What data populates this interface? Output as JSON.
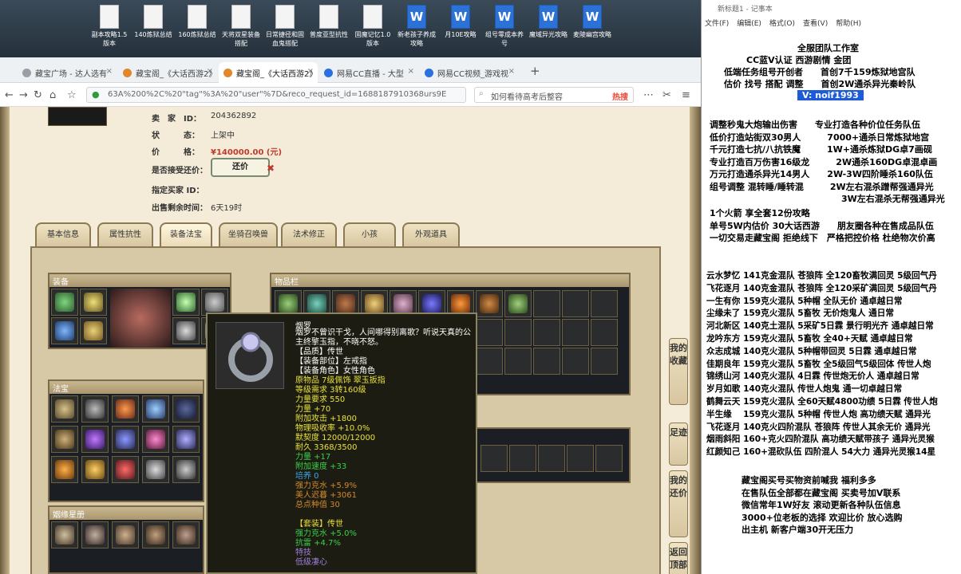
{
  "desktop": {
    "icons": [
      "副本攻略1.5版本",
      "140炼狱总结",
      "160炼狱总结",
      "天将双星装备搭配",
      "日常捷径和固血鬼搭配",
      "普度亚型抗性",
      "固魔记忆1.0版本",
      "新老孩子养成攻略",
      "月10E攻略",
      "组号零成本养号",
      "魔域异光攻略",
      "麦陵幽宫攻略"
    ]
  },
  "browser": {
    "tabs": [
      {
        "label": "藏宝广场 - 达人选有",
        "active": false
      },
      {
        "label": "藏宝阁_《大话西游2》",
        "active": false
      },
      {
        "label": "藏宝阁_《大话西游2》",
        "active": true
      },
      {
        "label": "网易CC直播 - 大型",
        "active": false
      },
      {
        "label": "网易CC视频_游戏视",
        "active": false
      }
    ],
    "url": "63A%200%2C%20\"tag\"%3A%20\"user\"%7D&reco_request_id=1688187910368urs9E",
    "search_placeholder": "如何看待高考后整容",
    "search_badge": "热搜"
  },
  "listing": {
    "seller_label": "卖　家　ID：",
    "seller_id": "204362892",
    "status_label": "状　　　态：",
    "status": "上架中",
    "price_label": "价　　　格：",
    "price": "¥140000.00 (元)",
    "offer_label": "是否接受还价：",
    "offer_button": "还价",
    "buyer_label": "指定买家 ID：",
    "buyer": "",
    "time_label": "出售剩余时间：",
    "time_left": "6天19时"
  },
  "game_tabs": [
    "基本信息",
    "属性抗性",
    "装备法宝",
    "坐骑召唤兽",
    "法术修正",
    "小孩",
    "外观道具"
  ],
  "sections": {
    "equip": "装备",
    "inventory": "物品栏",
    "treasure": "法宝",
    "star": "姻缘星册"
  },
  "side_tabs": [
    "我的收藏",
    "足迹",
    "我的还价",
    "返回顶部"
  ],
  "tooltip": {
    "name": "烟罗",
    "desc": "烟罗不曾识干戈，人间哪得别离歌？听说天真的公主终擎玉指，不晓不怒。",
    "lines": [
      {
        "t": "【品质】传世",
        "c": "#ffffff"
      },
      {
        "t": "【装备部位】左戒指",
        "c": "#ffffff"
      },
      {
        "t": "【装备角色】女性角色",
        "c": "#ffffff"
      },
      {
        "t": "原物品 7级佩饰 翠玉扳指",
        "c": "#e8e23a"
      },
      {
        "t": "等级需求 3转160级",
        "c": "#e8e23a"
      },
      {
        "t": "力量要求 550",
        "c": "#e8e23a"
      },
      {
        "t": "力量 +70",
        "c": "#e8e23a"
      },
      {
        "t": "附加攻击 +1800",
        "c": "#e8e23a"
      },
      {
        "t": "物理吸收率 +10.0%",
        "c": "#e8e23a"
      },
      {
        "t": "默契度 12000/12000",
        "c": "#e8e23a"
      },
      {
        "t": "耐久 3368/3500",
        "c": "#e8e23a"
      },
      {
        "t": "力量 +17",
        "c": "#39d14a"
      },
      {
        "t": "附加速度 +33",
        "c": "#39d14a"
      },
      {
        "t": "培养 0",
        "c": "#3aa7e8"
      },
      {
        "t": "强力克水 +5.9%",
        "c": "#d08a2e"
      },
      {
        "t": "美人迟暮 +3061",
        "c": "#d08a2e"
      },
      {
        "t": "总点种值 30",
        "c": "#d08a2e"
      },
      {
        "t": "",
        "c": "#fff"
      },
      {
        "t": "【套装】传世",
        "c": "#e8e23a"
      },
      {
        "t": "强力克水 +5.0%",
        "c": "#39d14a"
      },
      {
        "t": "抗雷 +4.7%",
        "c": "#39d14a"
      },
      {
        "t": "特技",
        "c": "#a07fe0"
      },
      {
        "t": "低级凄心",
        "c": "#a07fe0"
      }
    ]
  },
  "notepad": {
    "title": "新标题1 - 记事本",
    "menu": [
      "文件(F)",
      "编辑(E)",
      "格式(O)",
      "查看(V)",
      "帮助(H)"
    ],
    "header": [
      "全服团队工作室",
      "CC蓝V认证 西游剧情 金团",
      "低端任务组号开创者　　首创7千159炼狱地宫队",
      "估价 找号 搭配 调整　　首创2W通杀异光秦岭队"
    ],
    "vx": "V:  noif1993",
    "services": [
      "调整秒鬼大炮输出伤害　　专业打造各种价位任务队伍",
      "低价打造站街双30男人　　　7000+通杀日常炼狱地宫",
      "千元打造七抗/八抗铁魔　　　1W+通杀炼狱DG卓7画砚",
      "专业打造百万伤害16级龙　　　2W通杀160DG卓混卓画",
      "万元打造通杀异光14男人　　2W-3W四阶睡杀160队伍",
      "组号调整 混转睡/睡转混　　　2W左右混杀蹭帮强通异光",
      "　　　　　　　　　　　　　　　3W左右混杀无帮强通异光"
    ],
    "promo": [
      "1个火箭 享全套12份攻略",
      "单号5W内估价 30大话西游　　朋友圈各种在售成品队伍",
      "一切交易走藏宝阁 拒绝线下　严格把控价格 杜绝物次价高"
    ],
    "teams": [
      "云水梦忆 141克金混队 苍狼阵 全120畜牧满回灵 5级回气丹",
      "飞花逐月 140克金混队 苍狼阵 全120采矿满回灵 5级回气丹",
      "一生有你 159克火混队 5种帽 全队无价 通卓越日常",
      "尘缘未了 159克火混队 5畜牧 无价炮鬼人 通日常",
      "河北新区 140克土混队 5采矿5日霖 景行明光齐 通卓越日常",
      "龙吟东方 159克火混队 5畜牧 全40+天赋 通卓越日常",
      "众志成城 140克火混队 5种帽带回灵 5日霖 通卓越日常",
      "佳期良年 159克火混队 5畜牧 全5级回气5级回体 传世人炮",
      "锦绣山河 140克火混队 4日霖 传世炮无价人 通卓越日常",
      "岁月如歌 140克火混队 传世人炮鬼 通一切卓越日常",
      "鹤舞云天 159克火混队 全60天赋4800功绩 5日霖 传世人炮",
      "半生缘　 159克火混队 5种帽 传世人炮 高功绩天赋 通异光",
      "飞花逐月 140克火四阶混队 苍狼阵 传世人其余无价 通异光",
      "烟雨斜阳 160+克火四阶混队 高功绩天赋带孩子 通异光灵猴",
      "红颜知己 160+混砍队伍 四阶混人 54大力 通异光灵猴14星"
    ],
    "footer": [
      "藏宝阁买号买物资前喊我 福利多多",
      "在售队伍全部都在藏宝阁 买卖号加V联系",
      "微信常年1W好友 滚动更新各种队伍信息",
      "3000+位老板的选择 欢迎比价 放心选购",
      "出主机 新客户端30开无压力"
    ]
  },
  "colors": {
    "accent_red": "#c0392b",
    "vx_bg": "#1e5bd6",
    "gold": "#e8e23a"
  }
}
